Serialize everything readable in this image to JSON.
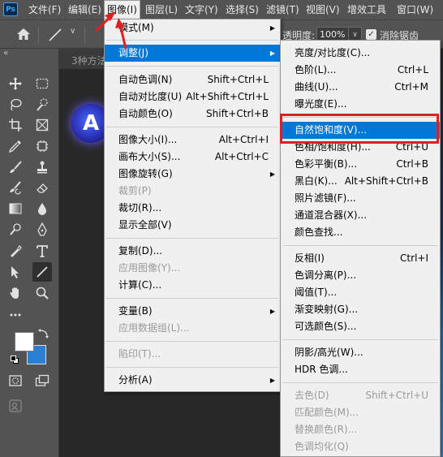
{
  "menubar": {
    "logo": "Ps",
    "items": [
      {
        "label": "文件(F)"
      },
      {
        "label": "编辑(E)"
      },
      {
        "label": "图像(I)"
      },
      {
        "label": "图层(L)"
      },
      {
        "label": "文字(Y)"
      },
      {
        "label": "选择(S)"
      },
      {
        "label": "滤镜(T)"
      },
      {
        "label": "视图(V)"
      },
      {
        "label": "增效工具"
      },
      {
        "label": "窗口(W)"
      }
    ]
  },
  "options_bar": {
    "opacity_label": "透明度:",
    "opacity_value": "100%",
    "anti_alias_checked": true,
    "anti_alias_label": "消除锯齿"
  },
  "toolbar": {
    "collapse": "«",
    "tools": [
      "move-icon",
      "marquee-icon",
      "lasso-icon",
      "quick-select-icon",
      "crop-icon",
      "frame-icon",
      "eyedropper-icon",
      "patch-icon",
      "brush-icon",
      "stamp-icon",
      "history-brush-icon",
      "eraser-icon",
      "gradient-icon",
      "blur-icon",
      "dodge-icon",
      "pen-icon",
      "pen-icon",
      "type-icon",
      "path-select-icon",
      "line-icon",
      "hand-icon",
      "zoom-icon",
      "more-icon",
      "swap-colors-icon",
      "foreground-color-icon",
      "quick-mask-icon",
      "screen-mode-icon",
      "content-credentials-icon"
    ],
    "foreground_color": "#ffffff",
    "background_color": "#2b7fd1"
  },
  "document": {
    "tab_label": "3种方法",
    "logo_letter": "A"
  },
  "image_menu": {
    "items": [
      {
        "label": "模式(M)",
        "submenu": true
      },
      {
        "label": "调整(J)",
        "submenu": true,
        "highlight": true
      },
      {
        "label": "自动色调(N)",
        "shortcut": "Shift+Ctrl+L"
      },
      {
        "label": "自动对比度(U)",
        "shortcut": "Alt+Shift+Ctrl+L"
      },
      {
        "label": "自动颜色(O)",
        "shortcut": "Shift+Ctrl+B"
      },
      {
        "label": "图像大小(I)...",
        "shortcut": "Alt+Ctrl+I"
      },
      {
        "label": "画布大小(S)...",
        "shortcut": "Alt+Ctrl+C"
      },
      {
        "label": "图像旋转(G)",
        "submenu": true
      },
      {
        "label": "裁剪(P)",
        "disabled": true
      },
      {
        "label": "裁切(R)..."
      },
      {
        "label": "显示全部(V)"
      },
      {
        "label": "复制(D)..."
      },
      {
        "label": "应用图像(Y)...",
        "disabled": true
      },
      {
        "label": "计算(C)..."
      },
      {
        "label": "变量(B)",
        "submenu": true
      },
      {
        "label": "应用数据组(L)...",
        "disabled": true
      },
      {
        "label": "陷印(T)...",
        "disabled": true
      },
      {
        "label": "分析(A)",
        "submenu": true
      }
    ]
  },
  "adjust_menu": {
    "items": [
      {
        "label": "亮度/对比度(C)..."
      },
      {
        "label": "色阶(L)...",
        "shortcut": "Ctrl+L"
      },
      {
        "label": "曲线(U)...",
        "shortcut": "Ctrl+M"
      },
      {
        "label": "曝光度(E)..."
      },
      {
        "label": "自然饱和度(V)...",
        "highlight": true
      },
      {
        "label": "色相/饱和度(H)...",
        "shortcut": "Ctrl+U"
      },
      {
        "label": "色彩平衡(B)...",
        "shortcut": "Ctrl+B"
      },
      {
        "label": "黑白(K)...",
        "shortcut": "Alt+Shift+Ctrl+B"
      },
      {
        "label": "照片滤镜(F)..."
      },
      {
        "label": "通道混合器(X)..."
      },
      {
        "label": "颜色查找..."
      },
      {
        "label": "反相(I)",
        "shortcut": "Ctrl+I"
      },
      {
        "label": "色调分离(P)..."
      },
      {
        "label": "阈值(T)..."
      },
      {
        "label": "渐变映射(G)..."
      },
      {
        "label": "可选颜色(S)..."
      },
      {
        "label": "阴影/高光(W)..."
      },
      {
        "label": "HDR 色调..."
      },
      {
        "label": "去色(D)",
        "shortcut": "Shift+Ctrl+U",
        "disabled": true
      },
      {
        "label": "匹配颜色(M)...",
        "disabled": true
      },
      {
        "label": "替换颜色(R)...",
        "disabled": true
      },
      {
        "label": "色调均化(Q)",
        "disabled": true
      }
    ]
  },
  "colors": {
    "menu_highlight": "#0078d7",
    "annotation_red": "#e02020",
    "ui_panel": "#535353"
  }
}
